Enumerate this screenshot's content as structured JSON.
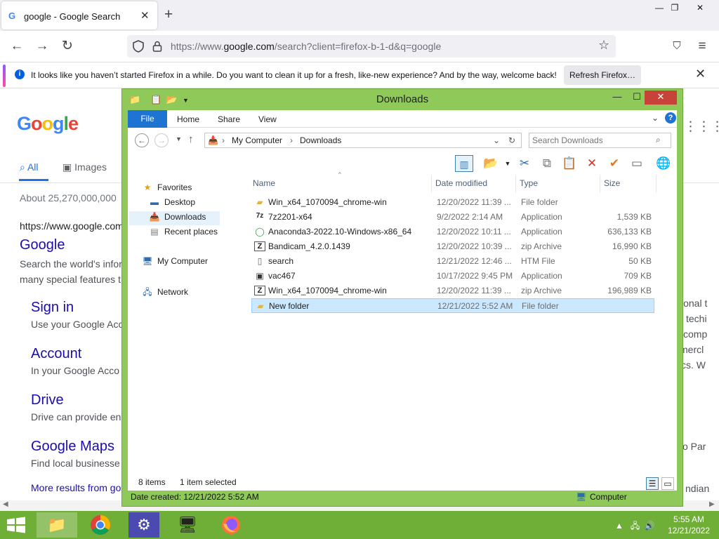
{
  "browser": {
    "tab_title": "google - Google Search",
    "tab_favicon": "G",
    "url_prefix": "https://www.",
    "url_domain": "google.com",
    "url_path": "/search?client=firefox-b-1-d&q=google",
    "notice_text": "It looks like you haven’t started Firefox in a while. Do you want to clean it up for a fresh, like-new experience? And by the way, welcome back!",
    "refresh_button": "Refresh Firefox…"
  },
  "google": {
    "tabs": [
      "All",
      "Images"
    ],
    "stats": "About 25,270,000,000",
    "result_url": "https://www.google.com",
    "result_title": "Google",
    "result_snippet_1": "Search the world's infor",
    "result_snippet_2": "many special features t",
    "sublinks": [
      {
        "title": "Sign in",
        "snippet": "Use your Google Acc"
      },
      {
        "title": "Account",
        "snippet": "In your Google Acco"
      },
      {
        "title": "Drive",
        "snippet": "Drive can provide en"
      },
      {
        "title": "Google Maps",
        "snippet": "Find local businesse"
      }
    ],
    "more_results": "More results from go",
    "right_fragments": [
      "ional t",
      "techi",
      "comp",
      "mercl",
      "cs. W",
      "o Par",
      "ndian"
    ]
  },
  "explorer": {
    "title": "Downloads",
    "ribbon_tabs": [
      "File",
      "Home",
      "Share",
      "View"
    ],
    "breadcrumb": [
      "My Computer",
      "Downloads"
    ],
    "search_placeholder": "Search Downloads",
    "nav": {
      "favorites": "Favorites",
      "desktop": "Desktop",
      "downloads": "Downloads",
      "recent": "Recent places",
      "computer": "My Computer",
      "network": "Network"
    },
    "columns": [
      "Name",
      "Date modified",
      "Type",
      "Size"
    ],
    "files": [
      {
        "name": "Win_x64_1070094_chrome-win",
        "date": "12/20/2022 11:39 ...",
        "type": "File folder",
        "size": "",
        "icon": "folder-icon"
      },
      {
        "name": "7z2201-x64",
        "date": "9/2/2022 2:14 AM",
        "type": "Application",
        "size": "1,539 KB",
        "icon": "7zip-icon"
      },
      {
        "name": "Anaconda3-2022.10-Windows-x86_64",
        "date": "12/20/2022 10:11 ...",
        "type": "Application",
        "size": "636,133 KB",
        "icon": "anaconda-icon"
      },
      {
        "name": "Bandicam_4.2.0.1439",
        "date": "12/20/2022 10:39 ...",
        "type": "zip Archive",
        "size": "16,990 KB",
        "icon": "zip-icon"
      },
      {
        "name": "search",
        "date": "12/21/2022 12:46 ...",
        "type": "HTM File",
        "size": "50 KB",
        "icon": "document-icon"
      },
      {
        "name": "vac467",
        "date": "10/17/2022 9:45 PM",
        "type": "Application",
        "size": "709 KB",
        "icon": "app-icon"
      },
      {
        "name": "Win_x64_1070094_chrome-win",
        "date": "12/20/2022 11:39 ...",
        "type": "zip Archive",
        "size": "196,989 KB",
        "icon": "zip-icon"
      },
      {
        "name": "New folder",
        "date": "12/21/2022 5:52 AM",
        "type": "File folder",
        "size": "",
        "icon": "folder-icon"
      }
    ],
    "status_items": "8 items",
    "status_selected": "1 item selected",
    "details_created": "Date created: 12/21/2022 5:52 AM",
    "details_location": "Computer"
  },
  "taskbar": {
    "time": "5:55 AM",
    "date": "12/21/2022"
  },
  "colors": {
    "window_frame": "#8fc95a",
    "taskbar": "#6fae37",
    "ribbon_file": "#1e74d3",
    "selection": "#cce8ff",
    "close_button": "#c7433a"
  }
}
